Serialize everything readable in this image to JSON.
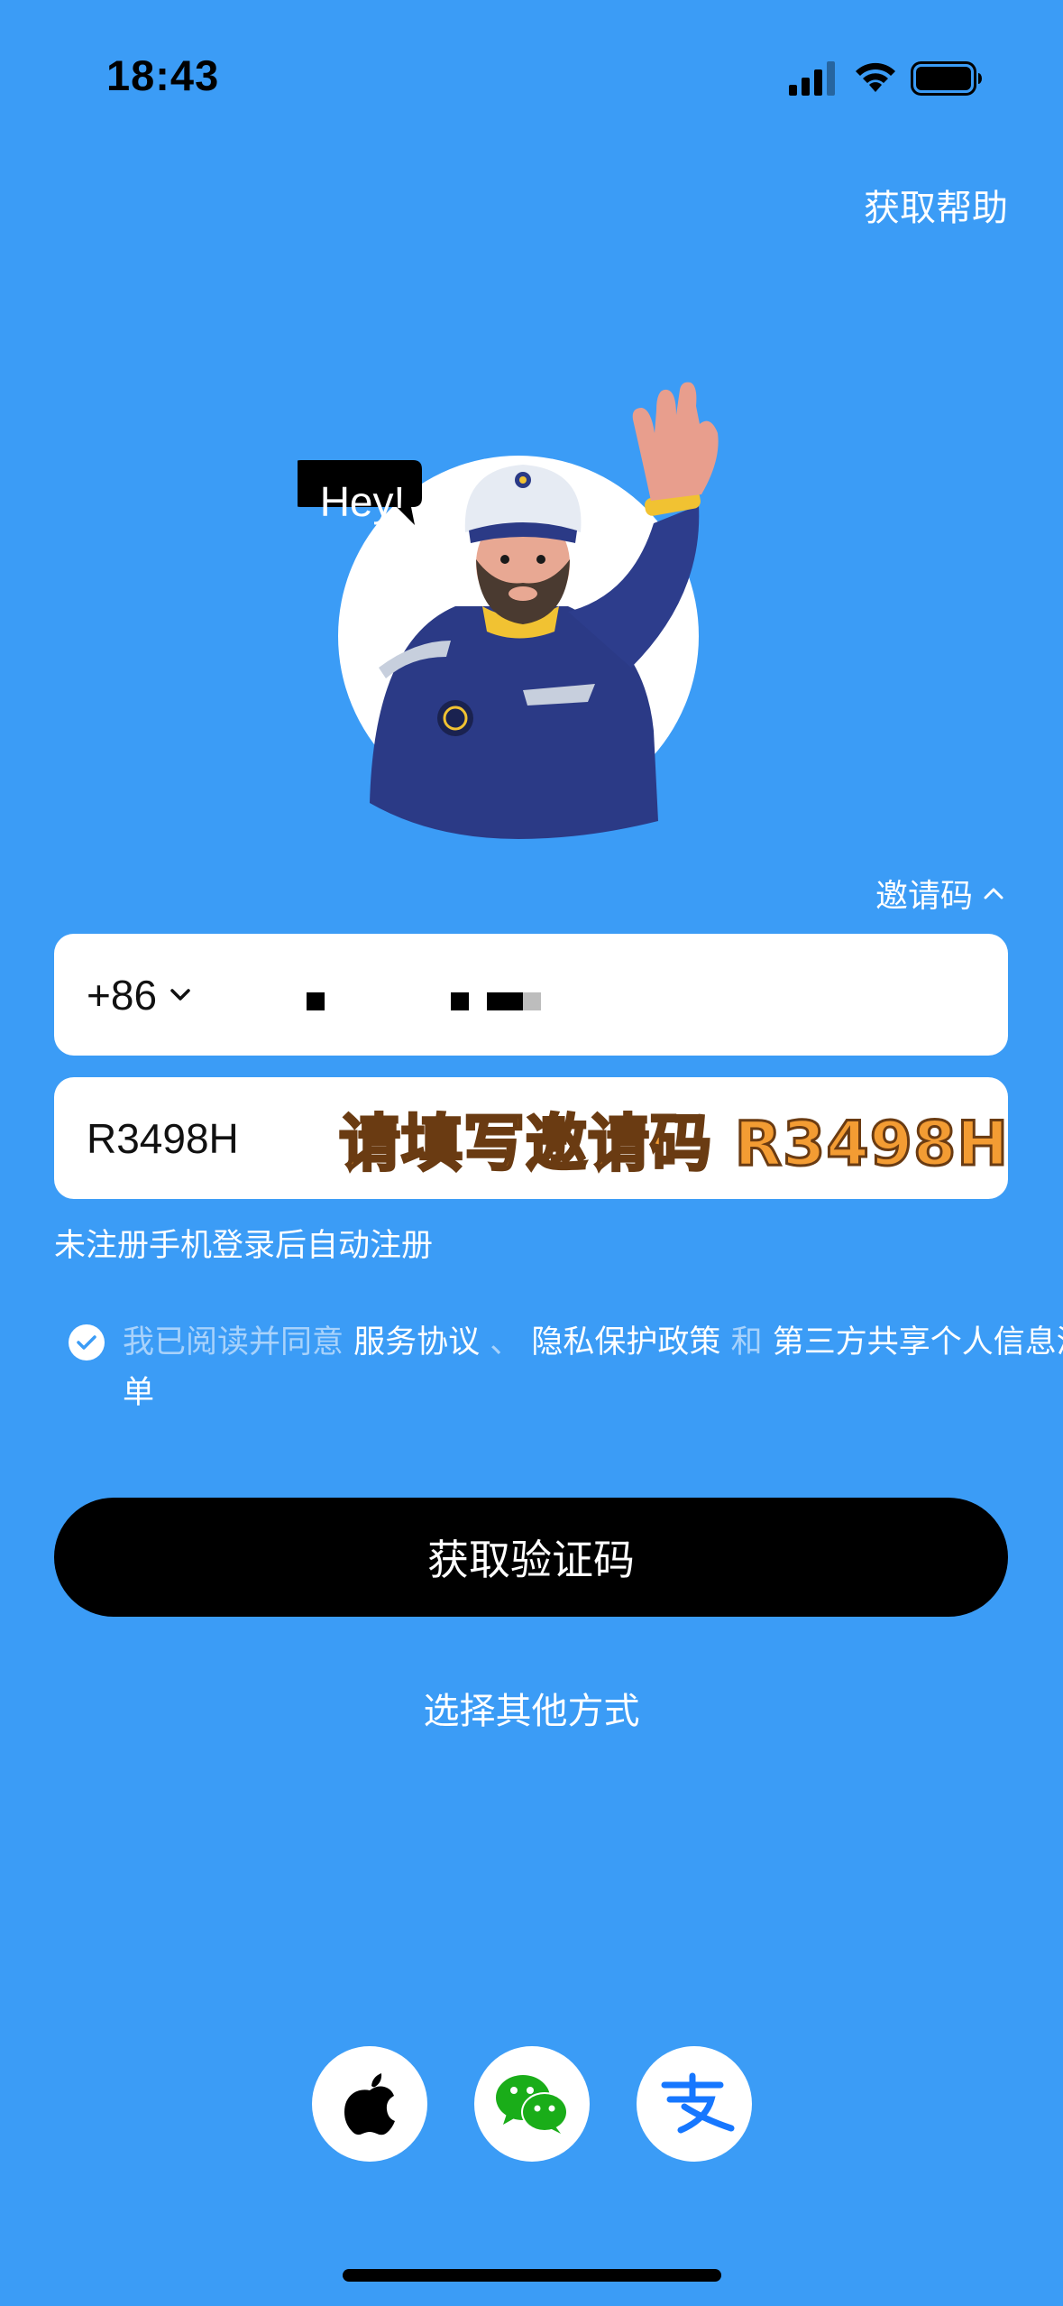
{
  "status_bar": {
    "time": "18:43"
  },
  "header": {
    "help_label": "获取帮助"
  },
  "mascot": {
    "speech": "Hey!"
  },
  "invite_toggle": {
    "label": "邀请码"
  },
  "phone_field": {
    "country_code": "+86"
  },
  "invite_field": {
    "value": "R3498H",
    "overlay_text": "请填写邀请码 R3498H"
  },
  "notes": {
    "auto_register": "未注册手机登录后自动注册"
  },
  "agreement": {
    "prefix": "我已阅读并同意 ",
    "service": "服务协议",
    "sep1": " 、 ",
    "privacy": "隐私保护政策",
    "and": " 和 ",
    "third_party": "第三方共享个人信息清单"
  },
  "actions": {
    "get_code": "获取验证码",
    "other_methods": "选择其他方式"
  },
  "social_logins": [
    {
      "icon": "apple-icon"
    },
    {
      "icon": "wechat-icon"
    },
    {
      "icon": "alipay-icon"
    }
  ],
  "colors": {
    "background": "#3b9cf6",
    "button": "#000000",
    "overlay_text": "#f39c33",
    "wechat": "#1aad19",
    "alipay": "#1677ff"
  }
}
